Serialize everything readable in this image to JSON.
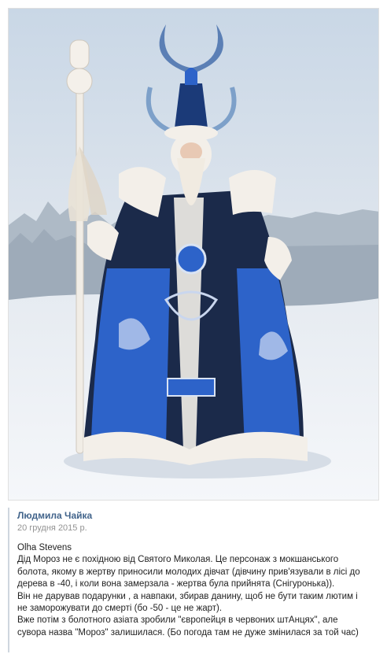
{
  "photo": {
    "alt": "",
    "colors": {
      "coat_blue": "#2d63c9",
      "coat_dark": "#1b2a4a",
      "fur": "#f3efe9",
      "snow": "#eef2f6",
      "sky": "#cfdbe8"
    }
  },
  "post": {
    "author": "Людмила Чайка",
    "date": "20 грудня 2015 р.",
    "lines": [
      "Olha Stevens",
      "Дід Мороз не є похідною від Святого Миколая. Це персонаж з мокшанського",
      "болота, якому в жертву приносили молодих дівчат (дівчину прив'язували в лісі до",
      "дерева в -40, і коли вона замерзала - жертва була прийнята (Снігуронька)).",
      "Він не дарував подарунки , а навпаки, збирав данину, щоб не бути таким лютим і",
      "не заморожувати до смерті (бо -50 - це не жарт).",
      "Вже потім з болотного азіата зробили \"європейця в червоних штАнцях\", але",
      "сувора назва \"Мороз\" залишилася. (Бо погода там не дуже змінилася за той час)"
    ]
  }
}
